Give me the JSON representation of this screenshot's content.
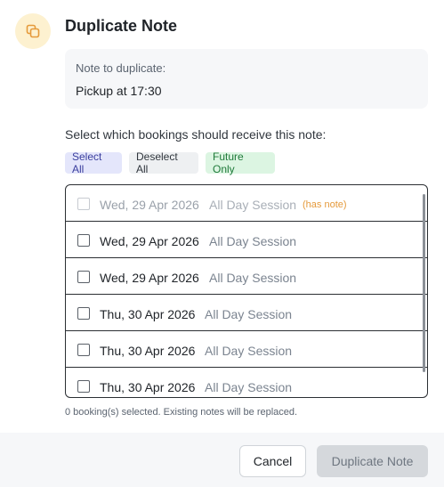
{
  "dialog": {
    "title": "Duplicate Note",
    "icon": "duplicate-icon",
    "accent_color": "#e59a3b",
    "icon_bg": "#fdf1d0"
  },
  "note": {
    "label": "Note to duplicate:",
    "text": "Pickup at 17:30"
  },
  "selection": {
    "prompt": "Select which bookings should receive this note:",
    "select_all_label": "Select All",
    "deselect_all_label": "Deselect All",
    "future_only_label": "Future Only"
  },
  "bookings": [
    {
      "date": "Wed, 29 Apr 2026",
      "session": "All Day Session",
      "note_flag": "(has note)",
      "disabled": true,
      "checked": false
    },
    {
      "date": "Wed, 29 Apr 2026",
      "session": "All Day Session",
      "note_flag": "",
      "disabled": false,
      "checked": false
    },
    {
      "date": "Wed, 29 Apr 2026",
      "session": "All Day Session",
      "note_flag": "",
      "disabled": false,
      "checked": false
    },
    {
      "date": "Thu, 30 Apr 2026",
      "session": "All Day Session",
      "note_flag": "",
      "disabled": false,
      "checked": false
    },
    {
      "date": "Thu, 30 Apr 2026",
      "session": "All Day Session",
      "note_flag": "",
      "disabled": false,
      "checked": false
    },
    {
      "date": "Thu, 30 Apr 2026",
      "session": "All Day Session",
      "note_flag": "",
      "disabled": false,
      "checked": false
    }
  ],
  "status": {
    "text": "0 booking(s) selected. Existing notes will be replaced."
  },
  "footer": {
    "cancel_label": "Cancel",
    "duplicate_label": "Duplicate Note"
  }
}
